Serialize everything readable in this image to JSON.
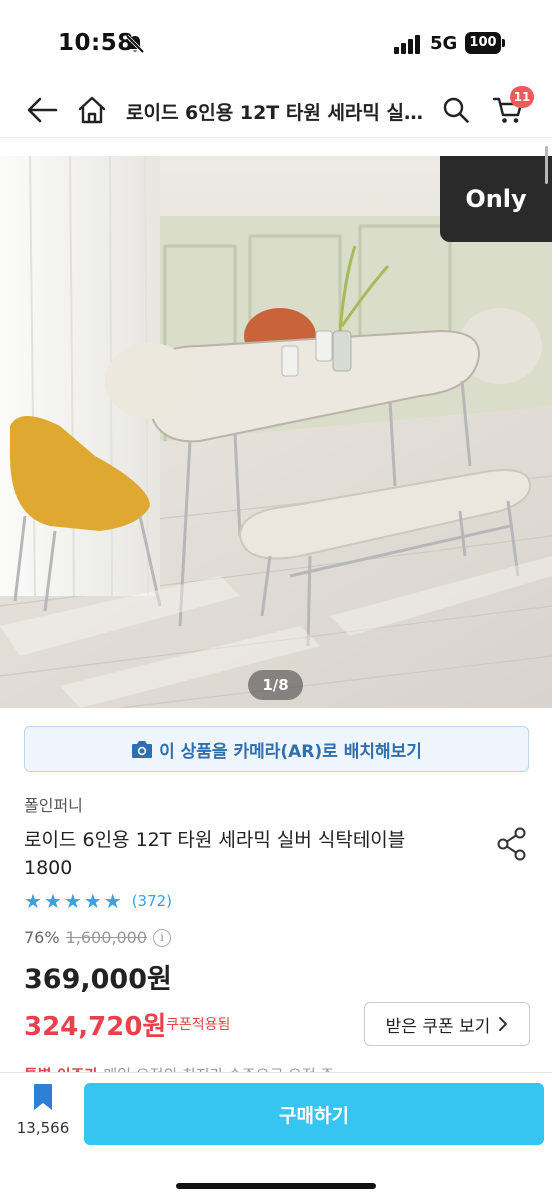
{
  "status_bar": {
    "time": "10:58",
    "network": "5G",
    "battery": "100"
  },
  "header": {
    "title": "로이드 6인용 12T 타원 세라믹 실버 식탁테이블 1800",
    "cart_count": "11",
    "icons": [
      "back-arrow-icon",
      "home-icon",
      "search-icon",
      "cart-icon"
    ]
  },
  "gallery": {
    "badge": "Only",
    "page_indicator": "1/8"
  },
  "ar_button": {
    "label": "이 상품을 카메라(AR)로 배치해보기"
  },
  "product": {
    "brand": "폴인퍼니",
    "title": "로이드 6인용 12T 타원 세라믹 실버 식탁테이블 1800",
    "rating_stars": 5,
    "review_count": "(372)",
    "discount_rate": "76%",
    "original_price": "1,600,000",
    "sale_price": "369,000원",
    "coupon_price": "324,720원",
    "coupon_note": "쿠폰적용됨",
    "coupon_button_label": "받은 쿠폰 보기",
    "promo_text_red": "특별 이주가",
    "promo_text_gray": "매일 오전의 최저가 순주으로 오전 주"
  },
  "bottom_bar": {
    "wishlist_count": "13,566",
    "buy_label": "구매하기"
  },
  "colors": {
    "accent": "#35c5f0",
    "price_red": "#e8414b",
    "star_blue": "#3aa0e0",
    "badge_red": "#f15a5a"
  }
}
